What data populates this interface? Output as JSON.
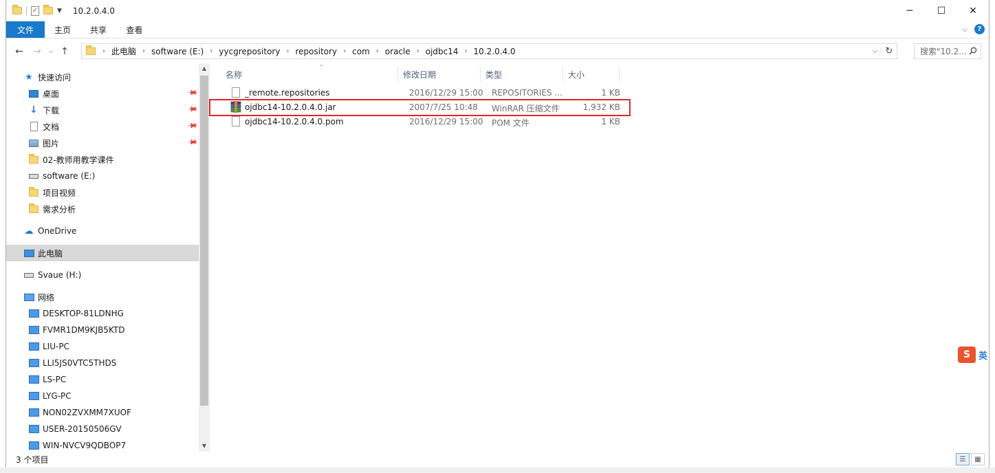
{
  "window": {
    "title": "10.2.0.4.0",
    "controls": {
      "minimize": "─",
      "maximize": "☐",
      "close": "✕"
    }
  },
  "ribbon": {
    "tabs": [
      {
        "label": "文件",
        "active": true
      },
      {
        "label": "主页",
        "active": false
      },
      {
        "label": "共享",
        "active": false
      },
      {
        "label": "查看",
        "active": false
      }
    ],
    "help": "?"
  },
  "address": {
    "crumbs": [
      "此电脑",
      "software (E:)",
      "yycgrepository",
      "repository",
      "com",
      "oracle",
      "ojdbc14",
      "10.2.0.4.0"
    ],
    "search_placeholder": "搜索\"10.2...",
    "dropdown": "⌵",
    "refresh": "↻"
  },
  "sidebar": {
    "items": [
      {
        "label": "快速访问",
        "icon": "star-icon",
        "indent": 1,
        "pinned": false
      },
      {
        "label": "桌面",
        "icon": "desktop-icon",
        "indent": 2,
        "pinned": true
      },
      {
        "label": "下载",
        "icon": "download-icon",
        "indent": 2,
        "pinned": true
      },
      {
        "label": "文档",
        "icon": "document-icon",
        "indent": 2,
        "pinned": true
      },
      {
        "label": "图片",
        "icon": "picture-icon",
        "indent": 2,
        "pinned": true
      },
      {
        "label": "02-教师用教学课件",
        "icon": "folder-icon",
        "indent": 2,
        "pinned": false
      },
      {
        "label": "software (E:)",
        "icon": "drive-icon",
        "indent": 2,
        "pinned": false
      },
      {
        "label": "项目视频",
        "icon": "folder-icon",
        "indent": 2,
        "pinned": false
      },
      {
        "label": "需求分析",
        "icon": "folder-icon",
        "indent": 2,
        "pinned": false
      },
      {
        "label": "OneDrive",
        "icon": "onedrive-icon",
        "indent": 1,
        "pinned": false
      },
      {
        "label": "此电脑",
        "icon": "this-pc-icon",
        "indent": 1,
        "pinned": false,
        "selected": true
      },
      {
        "label": "Svaue (H:)",
        "icon": "drive-icon",
        "indent": 1,
        "pinned": false
      },
      {
        "label": "网络",
        "icon": "network-icon",
        "indent": 1,
        "pinned": false
      },
      {
        "label": "DESKTOP-81LDNHG",
        "icon": "computer-icon",
        "indent": 2,
        "pinned": false
      },
      {
        "label": "FVMR1DM9KJB5KTD",
        "icon": "computer-icon",
        "indent": 2,
        "pinned": false
      },
      {
        "label": "LIU-PC",
        "icon": "computer-icon",
        "indent": 2,
        "pinned": false
      },
      {
        "label": "LLI5JS0VTC5THDS",
        "icon": "computer-icon",
        "indent": 2,
        "pinned": false
      },
      {
        "label": "LS-PC",
        "icon": "computer-icon",
        "indent": 2,
        "pinned": false
      },
      {
        "label": "LYG-PC",
        "icon": "computer-icon",
        "indent": 2,
        "pinned": false
      },
      {
        "label": "NON02ZVXMM7XUOF",
        "icon": "computer-icon",
        "indent": 2,
        "pinned": false
      },
      {
        "label": "USER-20150506GV",
        "icon": "computer-icon",
        "indent": 2,
        "pinned": false
      },
      {
        "label": "WIN-NVCV9QDBOP7",
        "icon": "computer-icon",
        "indent": 2,
        "pinned": false
      }
    ]
  },
  "columns": {
    "name": "名称",
    "modified": "修改日期",
    "type": "类型",
    "size": "大小"
  },
  "files": [
    {
      "name": "_remote.repositories",
      "modified": "2016/12/29 15:00",
      "type": "REPOSITORIES ...",
      "size": "1 KB",
      "icon": "file-icon"
    },
    {
      "name": "ojdbc14-10.2.0.4.0.jar",
      "modified": "2007/7/25 10:48",
      "type": "WinRAR 压缩文件",
      "size": "1,932 KB",
      "icon": "winrar-icon"
    },
    {
      "name": "ojdbc14-10.2.0.4.0.pom",
      "modified": "2016/12/29 15:00",
      "type": "POM 文件",
      "size": "1 KB",
      "icon": "file-icon"
    }
  ],
  "status": {
    "count": "3 个项目"
  },
  "ime": {
    "logo": "S",
    "mode": "英"
  },
  "colors": {
    "accent": "#1979ca",
    "highlight": "#e0262a"
  }
}
